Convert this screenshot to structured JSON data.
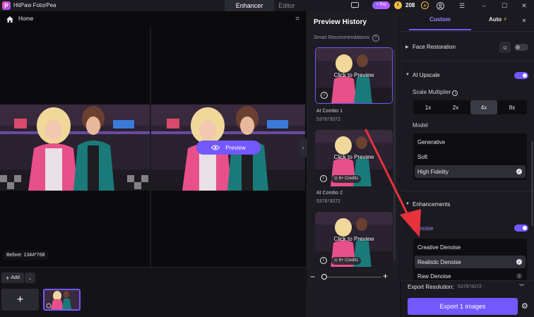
{
  "app": {
    "title": "HitPaw FotorPea",
    "logo_letter": "P"
  },
  "topbar": {
    "tabs": [
      {
        "label": "Enhancer",
        "active": true
      },
      {
        "label": "Editor",
        "active": false
      }
    ],
    "pro_badge": "Pro",
    "credits": "208",
    "icons": [
      "message-icon",
      "pro-icon",
      "coin-icon",
      "add-credits-icon",
      "user-icon",
      "menu-icon",
      "minimize-icon",
      "maximize-icon",
      "close-icon"
    ]
  },
  "canvas": {
    "home_label": "Home",
    "preview_button": "Preview",
    "before_label": "Before: 1344*768"
  },
  "bottom": {
    "add_label": "Add"
  },
  "history": {
    "title": "Preview History",
    "smart_recommendations": "Smart Recommendations",
    "cards": [
      {
        "overlay": "Click to Preview",
        "name": "AI Combo 1",
        "resolution": "5376*3072",
        "credits": "",
        "selected": true
      },
      {
        "overlay": "Click to Preview",
        "name": "AI Combo 2",
        "resolution": "5376*3072",
        "credits": "6+ Credits",
        "selected": false
      },
      {
        "overlay": "Click to Preview",
        "name": "",
        "resolution": "",
        "credits": "6+ Credits",
        "selected": false
      }
    ]
  },
  "settings": {
    "tab_custom": "Custom",
    "tab_auto": "Auto",
    "face_restoration": {
      "label": "Face Restoration",
      "enabled": false
    },
    "ai_upscale": {
      "label": "AI Upscale",
      "enabled": true
    },
    "scale_multiplier": {
      "label": "Scale Multiplier",
      "options": [
        "1x",
        "2x",
        "4x",
        "8x"
      ],
      "selected": "4x"
    },
    "model": {
      "label": "Model",
      "options": [
        "Generative",
        "Soft",
        "High Fidelity"
      ],
      "selected": "High Fidelity"
    },
    "enhancements": {
      "label": "Enhancements"
    },
    "denoise": {
      "label": "Denoise",
      "enabled": true,
      "options": [
        "Creative Denoise",
        "Realistic Denoise",
        "Raw Denoise"
      ],
      "selected": "Realistic Denoise"
    },
    "export_resolution": {
      "label": "Export Resolution:",
      "value": "5376*3072"
    },
    "export_button": "Export 1 images"
  },
  "colors": {
    "accent": "#7357ff",
    "background": "#0e0e12",
    "panel": "#1a1a20",
    "annotation": "#e8323c"
  }
}
